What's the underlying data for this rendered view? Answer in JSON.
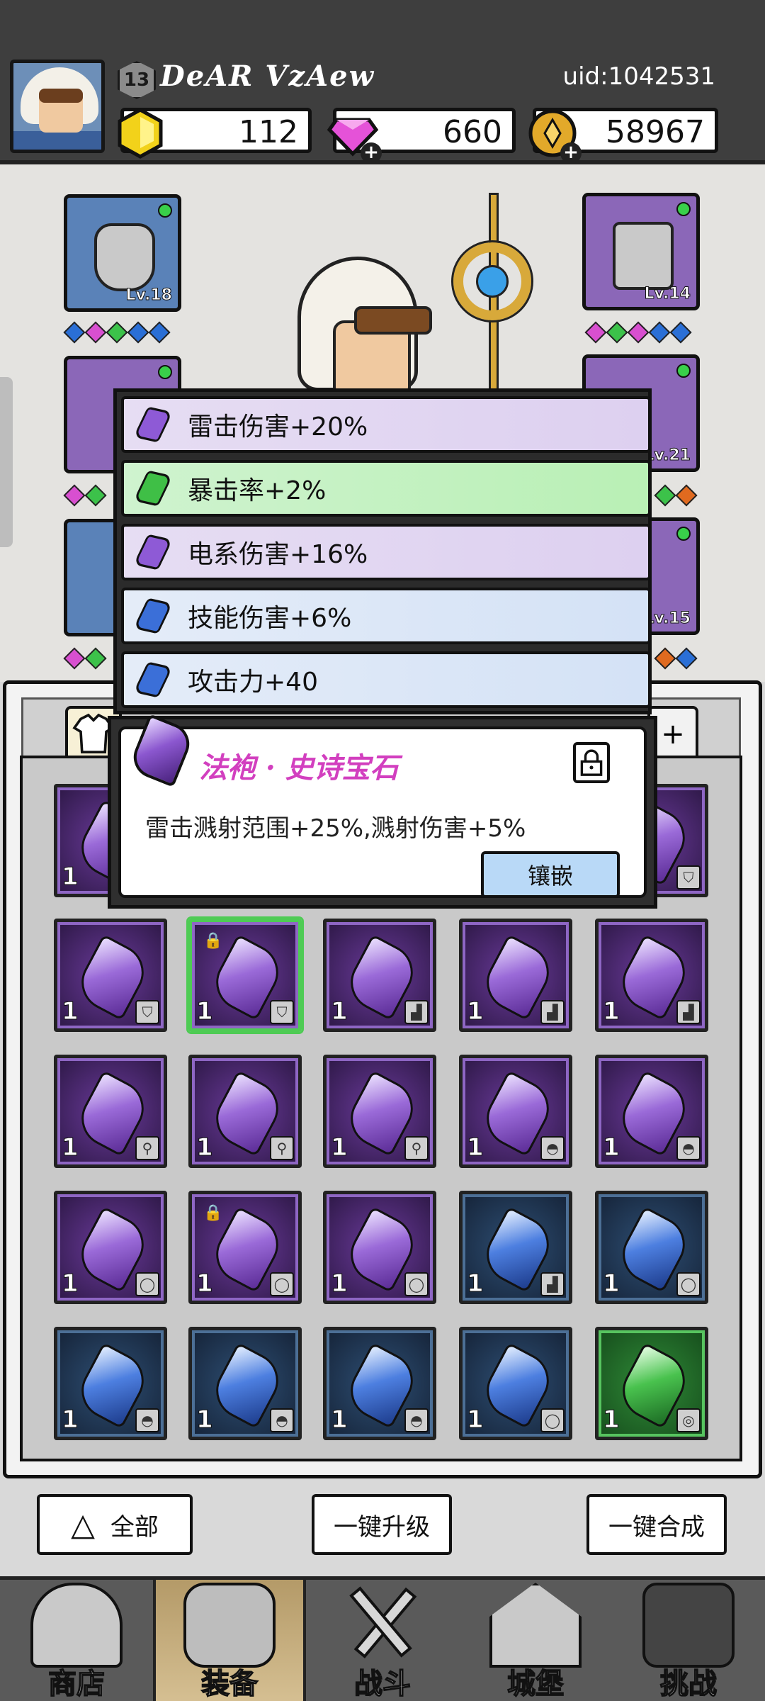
{
  "header": {
    "level": "13",
    "player_name": "DeAR VzAew",
    "uid": "uid:1042531",
    "resources": [
      {
        "name": "gold-gem",
        "value": "112",
        "color": "#f2d21a",
        "has_plus": false
      },
      {
        "name": "diamond",
        "value": "660",
        "color": "#e552d8",
        "has_plus": true
      },
      {
        "name": "coin",
        "value": "58967",
        "color": "#e2a92a",
        "has_plus": true
      }
    ]
  },
  "equipment": {
    "slots": [
      {
        "id": "helmet",
        "level": "Lv.18",
        "rarity": "blue"
      },
      {
        "id": "weapon-arm",
        "level": "Lv.14",
        "rarity": "purple"
      },
      {
        "id": "armor",
        "level": "",
        "rarity": "purple"
      },
      {
        "id": "ring",
        "level": "Lv.21",
        "rarity": "purple"
      },
      {
        "id": "boots",
        "level": "",
        "rarity": "blue"
      },
      {
        "id": "necklace",
        "level": "Lv.15",
        "rarity": "purple"
      }
    ]
  },
  "attributes": [
    {
      "text": "雷击伤害+20%",
      "rarity": "purple"
    },
    {
      "text": "暴击率+2%",
      "rarity": "green"
    },
    {
      "text": "电系伤害+16%",
      "rarity": "purple"
    },
    {
      "text": "技能伤害+6%",
      "rarity": "blue"
    },
    {
      "text": "攻击力+40",
      "rarity": "blue"
    }
  ],
  "popup": {
    "title": "法袍 · 史诗宝石",
    "description": "雷击溅射范围+25%,溅射伤害+5%",
    "button": "镶嵌"
  },
  "inventory": [
    {
      "rarity": "epic",
      "qty": "1",
      "type": "robe",
      "locked": false
    },
    {
      "rarity": "epic",
      "qty": "1",
      "type": "robe",
      "locked": false
    },
    {
      "rarity": "epic",
      "qty": "1",
      "type": "robe",
      "locked": false
    },
    {
      "rarity": "epic",
      "qty": "1",
      "type": "robe",
      "locked": true,
      "selected": true
    },
    {
      "rarity": "epic",
      "qty": "1",
      "type": "boots",
      "locked": false
    },
    {
      "rarity": "epic",
      "qty": "1",
      "type": "boots",
      "locked": false
    },
    {
      "rarity": "epic",
      "qty": "1",
      "type": "boots",
      "locked": false
    },
    {
      "rarity": "epic",
      "qty": "1",
      "type": "staff",
      "locked": false
    },
    {
      "rarity": "epic",
      "qty": "1",
      "type": "staff",
      "locked": false
    },
    {
      "rarity": "epic",
      "qty": "1",
      "type": "staff",
      "locked": false
    },
    {
      "rarity": "epic",
      "qty": "1",
      "type": "hat",
      "locked": false
    },
    {
      "rarity": "epic",
      "qty": "1",
      "type": "hat",
      "locked": false
    },
    {
      "rarity": "epic",
      "qty": "1",
      "type": "necklace",
      "locked": false
    },
    {
      "rarity": "epic",
      "qty": "1",
      "type": "necklace",
      "locked": true
    },
    {
      "rarity": "epic",
      "qty": "1",
      "type": "necklace",
      "locked": false
    },
    {
      "rarity": "rare",
      "qty": "1",
      "type": "boots",
      "locked": false
    },
    {
      "rarity": "rare",
      "qty": "1",
      "type": "hat",
      "locked": false
    },
    {
      "rarity": "rare",
      "qty": "1",
      "type": "hat",
      "locked": false
    },
    {
      "rarity": "rare",
      "qty": "1",
      "type": "hat",
      "locked": false
    },
    {
      "rarity": "rare",
      "qty": "1",
      "type": "necklace",
      "locked": false
    },
    {
      "rarity": "rare",
      "qty": "1",
      "type": "necklace",
      "locked": false
    },
    {
      "rarity": "uncommon",
      "qty": "1",
      "type": "ring",
      "locked": false
    }
  ],
  "actions": {
    "filter_label": "全部",
    "upgrade_all_label": "一键升级",
    "merge_all_label": "一键合成"
  },
  "nav": [
    {
      "id": "shop",
      "label": "商店",
      "active": false
    },
    {
      "id": "equipment",
      "label": "装备",
      "active": true
    },
    {
      "id": "battle",
      "label": "战斗",
      "active": false
    },
    {
      "id": "castle",
      "label": "城堡",
      "active": false
    },
    {
      "id": "challenge",
      "label": "挑战",
      "active": false
    }
  ]
}
